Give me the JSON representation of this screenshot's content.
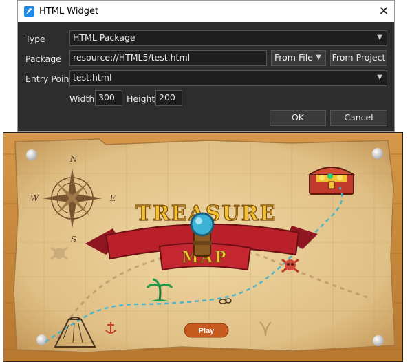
{
  "dialog": {
    "title": "HTML Widget",
    "close_glyph": "✕",
    "type_label": "Type",
    "type_value": "HTML Package",
    "package_label": "Package",
    "package_value": "resource://HTML5/test.html",
    "from_file_label": "From File",
    "from_project_label": "From Project",
    "entry_point_label": "Entry Point",
    "entry_point_value": "test.html",
    "width_label": "Width",
    "width_value": "300",
    "height_label": "Height",
    "height_value": "200",
    "ok_label": "OK",
    "cancel_label": "Cancel"
  },
  "preview": {
    "logo_line1": "TREASURE",
    "logo_line2": "MAP",
    "compass_n": "N",
    "compass_e": "E",
    "compass_s": "S",
    "compass_w": "W",
    "play_label": "Play"
  },
  "colors": {
    "dialog_bg": "#2d2d2d",
    "wood": "#c98a3c",
    "parchment": "#e4c68f",
    "ribbon": "#b9202a",
    "path": "#4fb6c9",
    "play_button": "#c75a1e"
  }
}
